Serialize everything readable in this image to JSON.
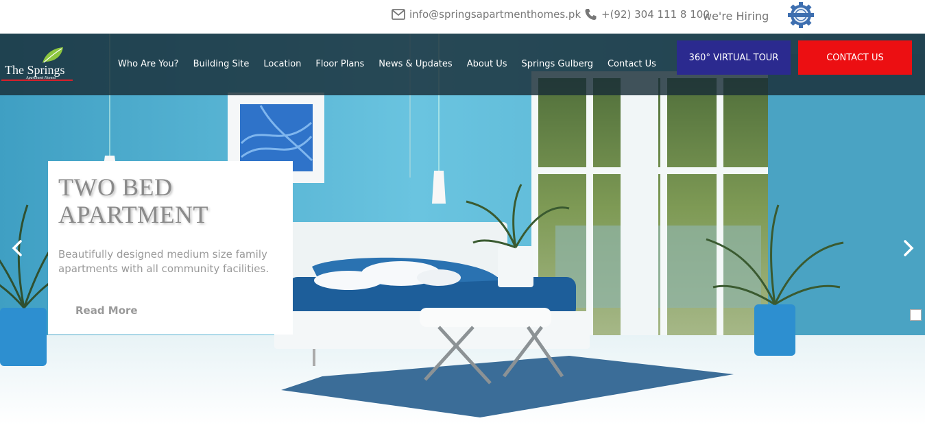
{
  "topbar": {
    "email": "info@springsapartmenthomes.pk",
    "phone": "+(92) 304 111 8 100",
    "hiring": "we're Hiring",
    "email_icon": "envelope-icon",
    "phone_icon": "phone-icon",
    "hiring_badge_icon": "hiring-gear-badge-icon"
  },
  "logo": {
    "name": "The Springs",
    "tagline": "Apartment Homes"
  },
  "nav": {
    "items": [
      {
        "label": "Who Are You?"
      },
      {
        "label": "Building Site"
      },
      {
        "label": "Location"
      },
      {
        "label": "Floor Plans"
      },
      {
        "label": "News & Updates"
      },
      {
        "label": "About Us"
      },
      {
        "label": "Springs Gulberg"
      },
      {
        "label": "Contact Us"
      }
    ],
    "tour_button": "360° VIRTUAL TOUR",
    "contact_button": "CONTACT US"
  },
  "slide": {
    "title": "TWO BED APARTMENT",
    "description": "Beautifully designed medium size family apartments with all community facilities.",
    "read_more": "Read More"
  },
  "colors": {
    "tour_button": "#2b2a8f",
    "contact_button": "#ec0f12",
    "navbar": "#192d37",
    "wall": "#5fb8d6"
  }
}
